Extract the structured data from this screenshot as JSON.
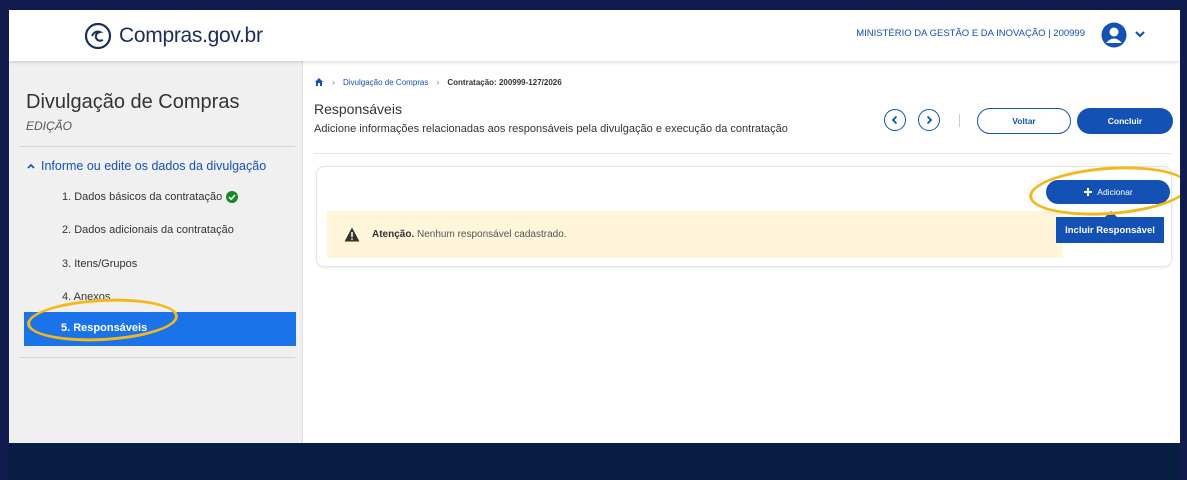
{
  "header": {
    "logo_text": "Compras.gov.br",
    "ministry": "MINISTÉRIO DA GESTÃO E DA INOVAÇÃO | 200999"
  },
  "sidebar": {
    "title": "Divulgação de Compras",
    "subtitle": "EDIÇÃO",
    "section_label": "Informe ou edite os dados da divulgação",
    "items": [
      {
        "label": "1. Dados básicos da contratação",
        "status": "complete"
      },
      {
        "label": "2. Dados adicionais da contratação"
      },
      {
        "label": "3. Itens/Grupos"
      },
      {
        "label": "4. Anexos"
      },
      {
        "label": "5. Responsáveis",
        "active": true
      }
    ]
  },
  "breadcrumb": {
    "items": [
      "Divulgação de Compras",
      "Contratação: 200999-127/2026"
    ]
  },
  "page": {
    "title": "Responsáveis",
    "description": "Adicione informações relacionadas aos responsáveis pela divulgação e execução da contratação"
  },
  "actions": {
    "back_label": "Voltar",
    "finish_label": "Concluir",
    "add_label": "Adicionar",
    "tooltip": "Incluir Responsável"
  },
  "alert": {
    "strong": "Atenção.",
    "message": " Nenhum responsável cadastrado."
  },
  "colors": {
    "primary": "#1351b4",
    "active_item": "#1a73e8",
    "highlight": "#f5b81c",
    "warning_bg": "#fef5db",
    "success": "#168821"
  }
}
